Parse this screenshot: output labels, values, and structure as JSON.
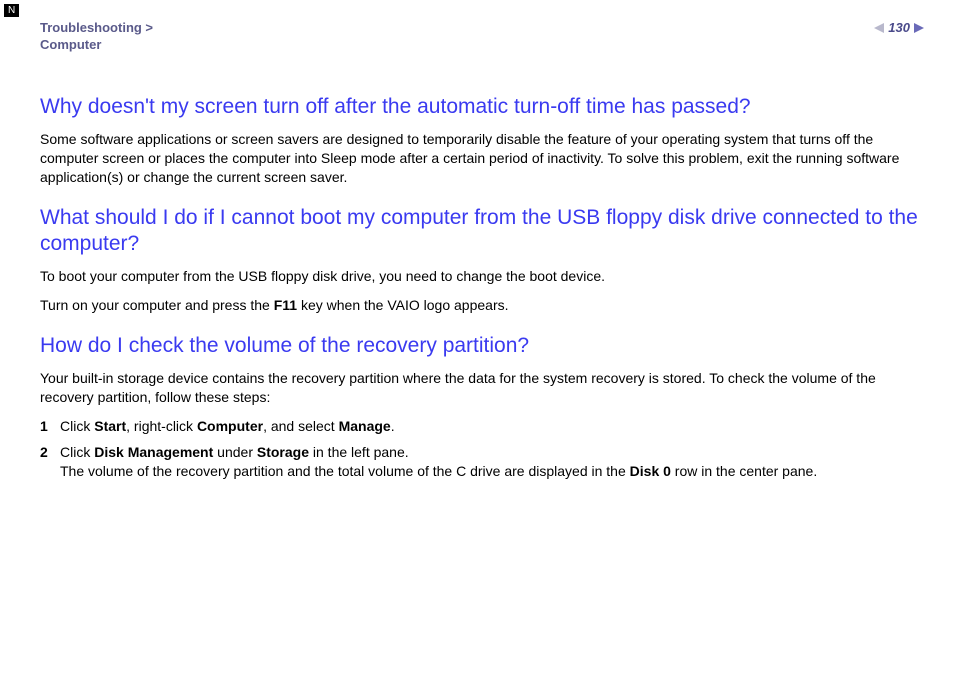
{
  "corner_marker": "N",
  "header": {
    "breadcrumb_line1": "Troubleshooting >",
    "breadcrumb_line2": "Computer",
    "page_number": "130"
  },
  "sections": [
    {
      "heading": "Why doesn't my screen turn off after the automatic turn-off time has passed?",
      "paragraphs": [
        "Some software applications or screen savers are designed to temporarily disable the feature of your operating system that turns off the computer screen or places the computer into Sleep mode after a certain period of inactivity. To solve this problem, exit the running software application(s) or change the current screen saver."
      ]
    },
    {
      "heading": "What should I do if I cannot boot my computer from the USB floppy disk drive connected to the computer?",
      "paragraphs": [
        "To boot your computer from the USB floppy disk drive, you need to change the boot device."
      ],
      "rich_line": {
        "pre": "Turn on your computer and press the ",
        "bold": "F11",
        "post": " key when the VAIO logo appears."
      }
    },
    {
      "heading": "How do I check the volume of the recovery partition?",
      "paragraphs": [
        "Your built-in storage device contains the recovery partition where the data for the system recovery is stored. To check the volume of the recovery partition, follow these steps:"
      ],
      "steps": [
        {
          "num": "1",
          "parts": [
            "Click ",
            "Start",
            ", right-click ",
            "Computer",
            ", and select ",
            "Manage",
            "."
          ]
        },
        {
          "num": "2",
          "parts": [
            "Click ",
            "Disk Management",
            " under ",
            "Storage",
            " in the left pane."
          ],
          "extra": [
            "The volume of the recovery partition and the total volume of the C drive are displayed in the ",
            "Disk 0",
            " row in the center pane."
          ]
        }
      ]
    }
  ]
}
